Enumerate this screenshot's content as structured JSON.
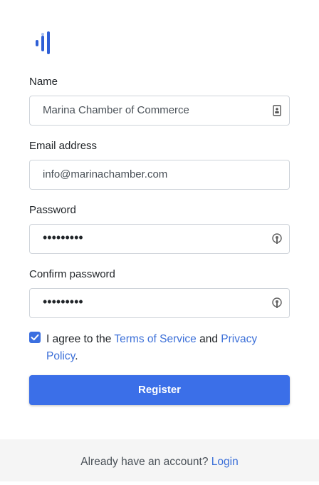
{
  "logo": {
    "icon": "bars-logo-icon",
    "color": "#2f5fd6"
  },
  "form": {
    "name": {
      "label": "Name",
      "value": "Marina Chamber of Commerce",
      "icon": "contact-card-icon"
    },
    "email": {
      "label": "Email address",
      "value": "info@marinachamber.com"
    },
    "password": {
      "label": "Password",
      "value": "•••••••••",
      "icon": "key-lock-icon"
    },
    "confirm_password": {
      "label": "Confirm password",
      "value": "•••••••••",
      "icon": "key-lock-icon"
    },
    "terms": {
      "checked": true,
      "text_before": "I agree to the ",
      "terms_link": "Terms of Service",
      "text_middle": " and ",
      "privacy_link": "Privacy Policy",
      "text_after": "."
    },
    "submit_label": "Register"
  },
  "footer": {
    "prompt": "Already have an account? ",
    "login_link": "Login"
  },
  "colors": {
    "accent": "#3b6fe8",
    "link": "#3b6fd8",
    "footer_bg": "#f5f5f5"
  }
}
